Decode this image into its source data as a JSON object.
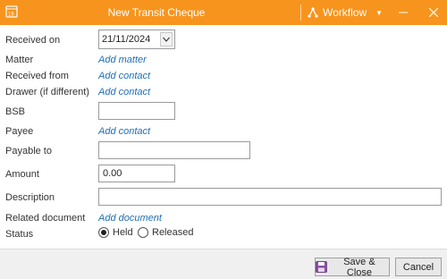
{
  "window": {
    "title": "New Transit Cheque",
    "app_icon": "ledger-icon",
    "workflow_label": "Workflow",
    "workflow_icon": "workflow-icon"
  },
  "form": {
    "received_on": {
      "label": "Received on",
      "value": "21/11/2024"
    },
    "matter": {
      "label": "Matter",
      "link": "Add matter"
    },
    "received_from": {
      "label": "Received from",
      "link": "Add contact"
    },
    "drawer": {
      "label": "Drawer (if different)",
      "link": "Add contact"
    },
    "bsb": {
      "label": "BSB",
      "value": ""
    },
    "payee": {
      "label": "Payee",
      "link": "Add contact"
    },
    "payable_to": {
      "label": "Payable to",
      "value": ""
    },
    "amount": {
      "label": "Amount",
      "value": "0.00"
    },
    "description": {
      "label": "Description",
      "value": ""
    },
    "related_document": {
      "label": "Related document",
      "link": "Add document"
    },
    "status": {
      "label": "Status",
      "options": [
        {
          "label": "Held",
          "selected": true
        },
        {
          "label": "Released",
          "selected": false
        }
      ]
    }
  },
  "footer": {
    "save_label": "Save & Close",
    "cancel_label": "Cancel"
  },
  "colors": {
    "titlebar": "#f7941d",
    "link": "#1f6fb5"
  }
}
